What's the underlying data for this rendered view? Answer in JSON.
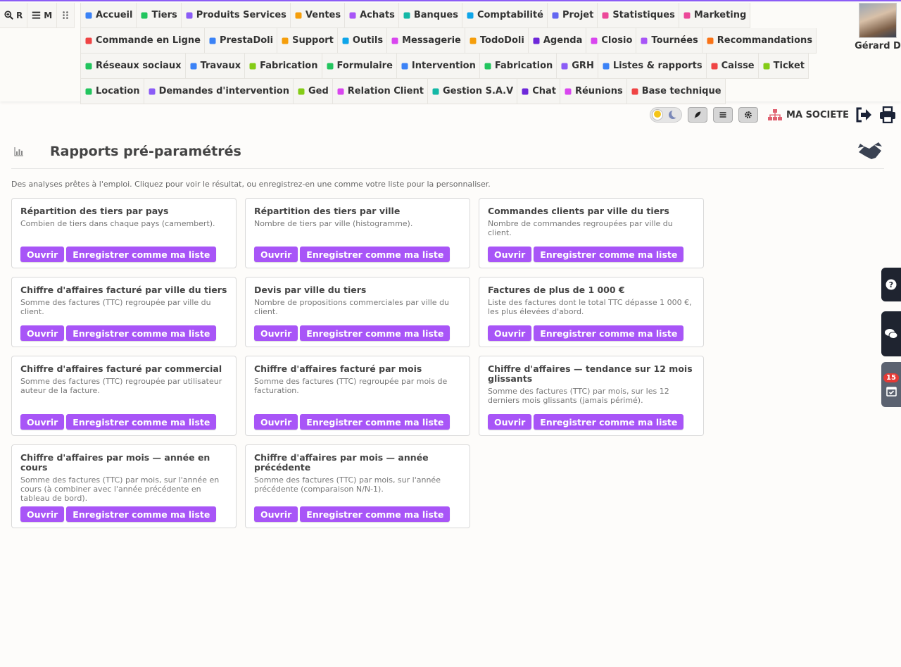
{
  "colors": {
    "accent": "#a855f7",
    "topline": "#8b5cf6",
    "dark_tab": "#1f2430",
    "badge": "#e53935"
  },
  "left_buttons": [
    {
      "label": "R",
      "icon": "search-plus-icon"
    },
    {
      "label": "M",
      "icon": "menu-icon"
    },
    {
      "label": "",
      "icon": "grip-icon"
    }
  ],
  "menu_rows": [
    [
      {
        "label": "Accueil",
        "icon": "home-icon",
        "color": "#3b82f6"
      },
      {
        "label": "Tiers",
        "icon": "building-icon",
        "color": "#22c55e"
      },
      {
        "label": "Produits Services",
        "icon": "cubes-icon",
        "color": "#8b5cf6"
      },
      {
        "label": "Ventes",
        "icon": "euro-icon",
        "color": "#f59e0b"
      },
      {
        "label": "Achats",
        "icon": "coins-icon",
        "color": "#a855f7"
      },
      {
        "label": "Banques",
        "icon": "bank-icon",
        "color": "#14b8a6"
      },
      {
        "label": "Comptabilité",
        "icon": "scale-icon",
        "color": "#0ea5e9"
      },
      {
        "label": "Projet",
        "icon": "sitemap-icon",
        "color": "#6366f1"
      },
      {
        "label": "Statistiques",
        "icon": "chart-icon",
        "color": "#ec4899"
      },
      {
        "label": "Marketing",
        "icon": "megaphone-icon",
        "color": "#ec4899"
      }
    ],
    [
      {
        "label": "Commande en Ligne",
        "icon": "order-icon",
        "color": "#ef4444"
      },
      {
        "label": "PrestaDoli",
        "icon": "sync-icon",
        "color": "#3b82f6"
      },
      {
        "label": "Support",
        "icon": "briefcase-medical-icon",
        "color": "#f59e0b"
      },
      {
        "label": "Outils",
        "icon": "tools-icon",
        "color": "#0ea5e9"
      },
      {
        "label": "Messagerie",
        "icon": "mail-icon",
        "color": "#d946ef"
      },
      {
        "label": "TodoDoli",
        "icon": "calendar-check-icon",
        "color": "#f59e0b"
      },
      {
        "label": "Agenda",
        "icon": "clock-icon",
        "color": "#6d28d9"
      },
      {
        "label": "Closio",
        "icon": "target-icon",
        "color": "#d946ef"
      },
      {
        "label": "Tournées",
        "icon": "route-icon",
        "color": "#a855f7"
      },
      {
        "label": "Recommandations",
        "icon": "bullhorn-icon",
        "color": "#f97316"
      }
    ],
    [
      {
        "label": "Réseaux sociaux",
        "icon": "broadcast-icon",
        "color": "#22c55e"
      },
      {
        "label": "Travaux",
        "icon": "road-icon",
        "color": "#3b82f6"
      },
      {
        "label": "Fabrication",
        "icon": "industry-icon",
        "color": "#84cc16"
      },
      {
        "label": "Formulaire",
        "icon": "form-icon",
        "color": "#22c55e"
      },
      {
        "label": "Intervention",
        "icon": "wrench-icon",
        "color": "#3b82f6"
      },
      {
        "label": "Fabrication",
        "icon": "battery-icon",
        "color": "#22c55e"
      },
      {
        "label": "GRH",
        "icon": "users-icon",
        "color": "#8b5cf6"
      },
      {
        "label": "Listes & rapports",
        "icon": "table-icon",
        "color": "#3b82f6"
      },
      {
        "label": "Caisse",
        "icon": "cash-register-icon",
        "color": "#ef4444"
      },
      {
        "label": "Ticket",
        "icon": "headset-icon",
        "color": "#84cc16"
      }
    ],
    [
      {
        "label": "Location",
        "icon": "truck-icon",
        "color": "#22c55e"
      },
      {
        "label": "Demandes d'intervention",
        "icon": "file-medical-icon",
        "color": "#8b5cf6"
      },
      {
        "label": "Ged",
        "icon": "folder-icon",
        "color": "#84cc16"
      },
      {
        "label": "Relation Client",
        "icon": "handshake-icon",
        "color": "#d946ef"
      },
      {
        "label": "Gestion S.A.V",
        "icon": "handshake-icon",
        "color": "#14b8a6"
      },
      {
        "label": "Chat",
        "icon": "comments-icon",
        "color": "#6d28d9"
      },
      {
        "label": "Réunions",
        "icon": "video-icon",
        "color": "#d946ef"
      },
      {
        "label": "Base technique",
        "icon": "book-icon",
        "color": "#ef4444"
      }
    ]
  ],
  "user": {
    "name": "Gérard D"
  },
  "toolbar": {
    "company": "MA SOCIETE"
  },
  "page": {
    "title": "Rapports pré-paramétrés",
    "intro": "Des analyses prêtes à l'emploi. Cliquez pour voir le résultat, ou enregistrez-en une comme votre liste pour la personnaliser."
  },
  "buttons": {
    "open": "Ouvrir",
    "save": "Enregistrer comme ma liste"
  },
  "cards": [
    {
      "title": "Répartition des tiers par pays",
      "desc": "Combien de tiers dans chaque pays (camembert)."
    },
    {
      "title": "Répartition des tiers par ville",
      "desc": "Nombre de tiers par ville (histogramme)."
    },
    {
      "title": "Commandes clients par ville du tiers",
      "desc": "Nombre de commandes regroupées par ville du client."
    },
    {
      "title": "Chiffre d'affaires facturé par ville du tiers",
      "desc": "Somme des factures (TTC) regroupée par ville du client."
    },
    {
      "title": "Devis par ville du tiers",
      "desc": "Nombre de propositions commerciales par ville du client."
    },
    {
      "title": "Factures de plus de 1 000 €",
      "desc": "Liste des factures dont le total TTC dépasse 1 000 €, les plus élevées d'abord."
    },
    {
      "title": "Chiffre d'affaires facturé par commercial",
      "desc": "Somme des factures (TTC) regroupée par utilisateur auteur de la facture."
    },
    {
      "title": "Chiffre d'affaires facturé par mois",
      "desc": "Somme des factures (TTC) regroupée par mois de facturation."
    },
    {
      "title": "Chiffre d'affaires — tendance sur 12 mois glissants",
      "desc": "Somme des factures (TTC) par mois, sur les 12 derniers mois glissants (jamais périmé)."
    },
    {
      "title": "Chiffre d'affaires par mois — année en cours",
      "desc": "Somme des factures (TTC) par mois, sur l'année en cours (à combiner avec l'année précédente en tableau de bord)."
    },
    {
      "title": "Chiffre d'affaires par mois — année précédente",
      "desc": "Somme des factures (TTC) par mois, sur l'année précédente (comparaison N/N-1)."
    }
  ],
  "side_tabs": {
    "badge": "15"
  }
}
